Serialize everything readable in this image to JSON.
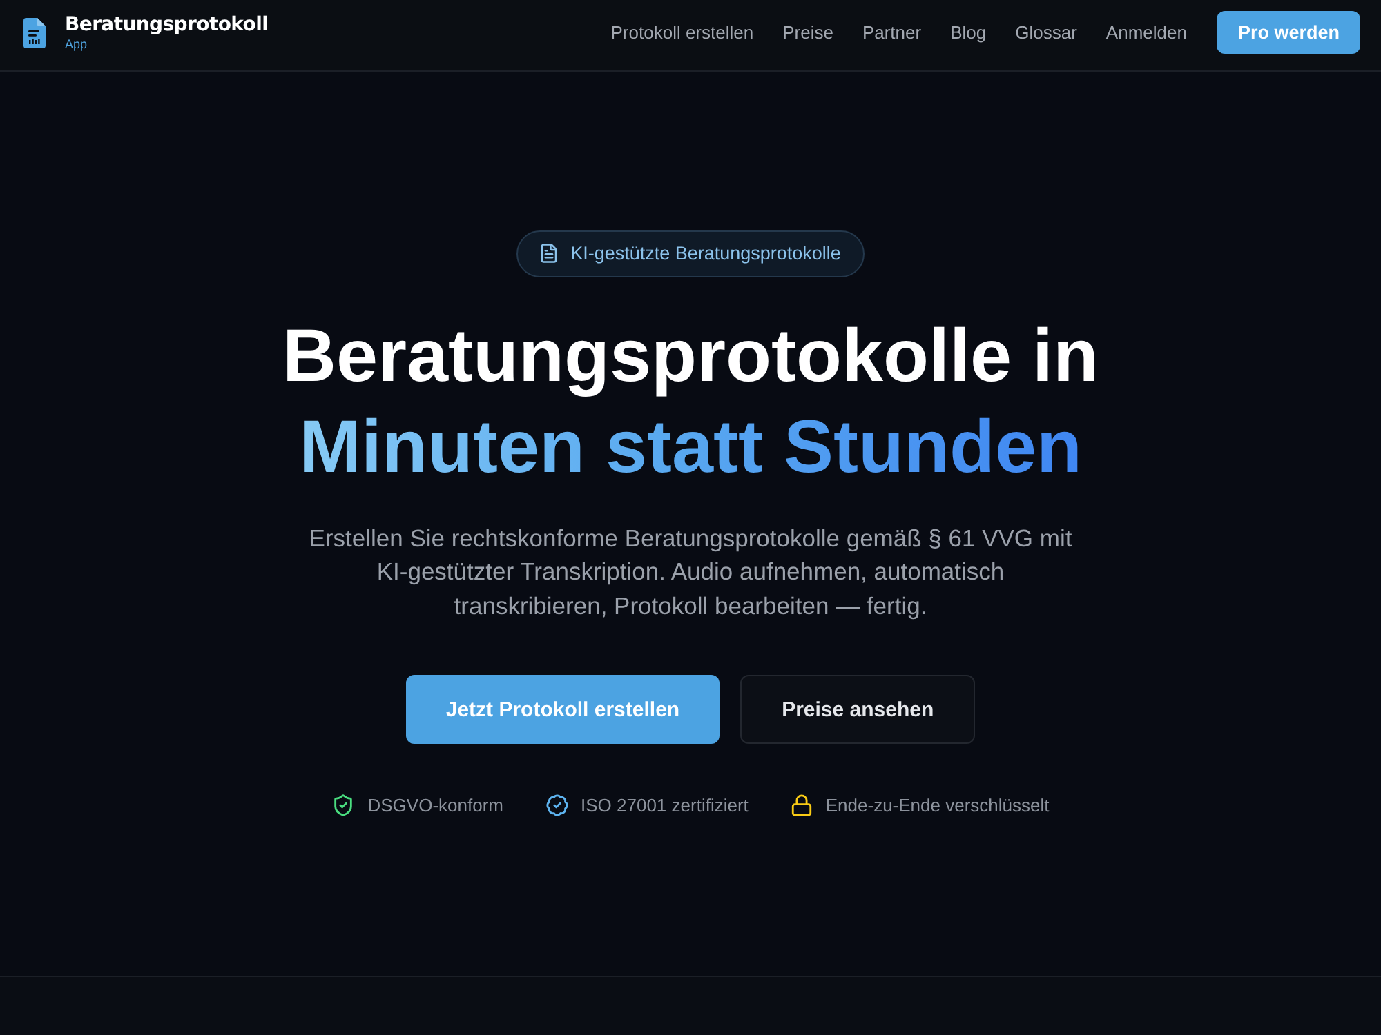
{
  "nav": {
    "brand": {
      "title": "Beratungsprotokoll",
      "subtitle": "App"
    },
    "links": [
      "Protokoll erstellen",
      "Preise",
      "Partner",
      "Blog",
      "Glossar",
      "Anmelden"
    ],
    "cta": "Pro werden"
  },
  "hero": {
    "badge": "KI-gestützte Beratungsprotokolle",
    "headline": {
      "line_1": "Beratungsprotokolle in",
      "line_2": "Minuten statt Stunden"
    },
    "description": "Erstellen Sie rechtskonforme Beratungsprotokolle gemäß § 61 VVG mit KI-gestützter Transkription. Audio aufnehmen, automatisch transkribieren, Protokoll bearbeiten — fertig.",
    "buttons": [
      {
        "label": "Jetzt Protokoll erstellen",
        "kind": "primary"
      },
      {
        "label": "Preise ansehen",
        "kind": "secondary"
      }
    ],
    "trust_badges": [
      {
        "label": "DSGVO-konform",
        "kind": "shield",
        "color": "#4ade80"
      },
      {
        "label": "ISO 27001 zertifiziert",
        "kind": "badge",
        "color": "#5eb4f0"
      },
      {
        "label": "Ende-zu-Ende verschlüsselt",
        "kind": "lock",
        "color": "#facc15"
      }
    ]
  }
}
